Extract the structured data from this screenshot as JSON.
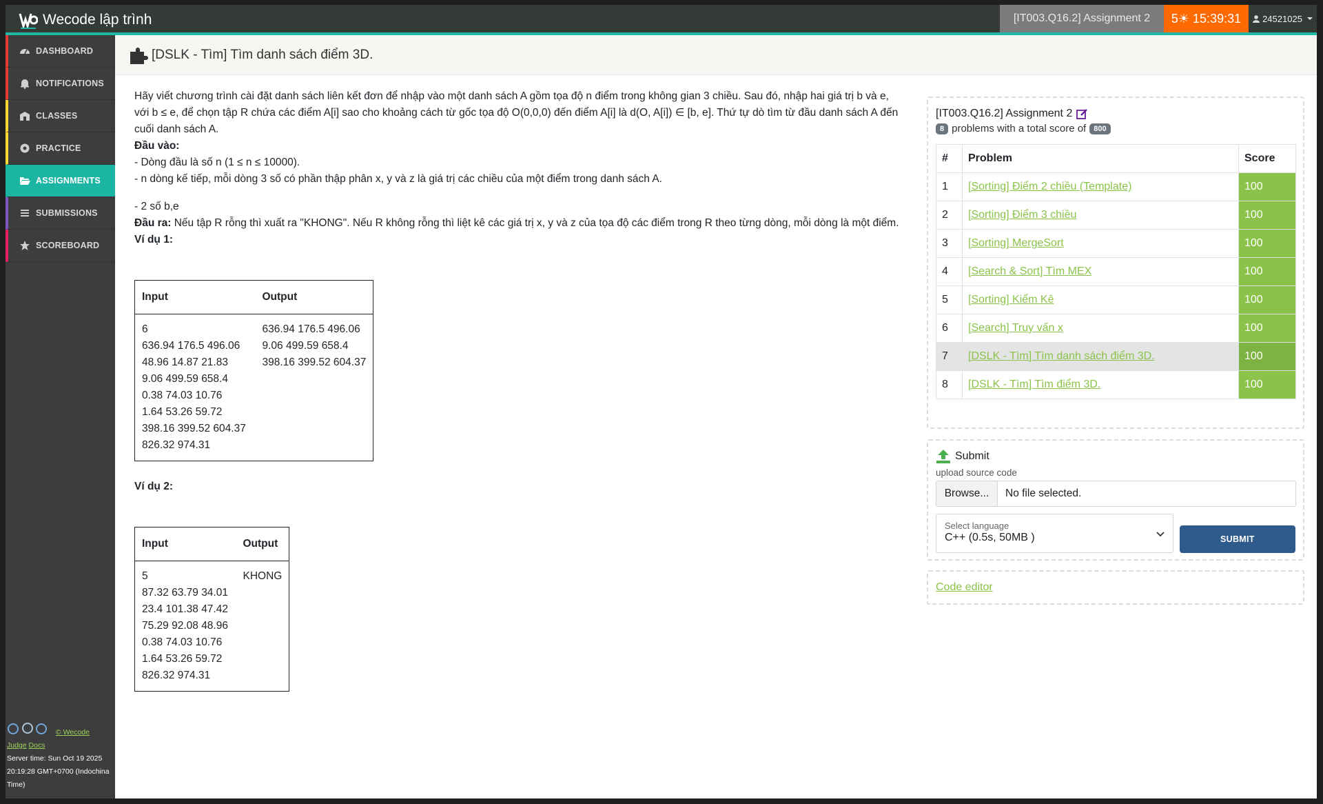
{
  "app": {
    "name": "Wecode lập trình"
  },
  "navbar": {
    "assignment": "[IT003.Q16.2] Assignment 2",
    "timer": "5☀ 15:39:31",
    "user": "24521025"
  },
  "sidebar": {
    "items": [
      {
        "label": "DASHBOARD",
        "icon": "dashboard-icon",
        "accent": "#e53935"
      },
      {
        "label": "NOTIFICATIONS",
        "icon": "bell-icon",
        "accent": "#e53935"
      },
      {
        "label": "CLASSES",
        "icon": "school-icon",
        "accent": "#fdd835"
      },
      {
        "label": "PRACTICE",
        "icon": "tools-icon",
        "accent": "#fdd835"
      },
      {
        "label": "ASSIGNMENTS",
        "icon": "folder-open-icon",
        "accent": "#1cb4a3"
      },
      {
        "label": "SUBMISSIONS",
        "icon": "list-icon",
        "accent": "#7e57c2"
      },
      {
        "label": "SCOREBOARD",
        "icon": "star-icon",
        "accent": "#e91e63"
      }
    ],
    "footer": {
      "credit": "© Wecode",
      "judge": "Judge",
      "docs": "Docs",
      "server_time": "Server time: Sun Oct 19 2025 20:19:28 GMT+0700 (Indochina Time)"
    }
  },
  "page": {
    "title": "[DSLK - Tìm] Tìm danh sách điểm 3D."
  },
  "problem": {
    "statement": "Hãy viết chương trình cài đặt danh sách liên kết đơn để nhập vào một danh sách A gồm tọa độ n điểm trong không gian 3 chiều. Sau đó, nhập hai giá trị b và e, với b ≤ e, để chọn tập R chứa các điểm A[i] sao cho khoảng cách từ gốc tọa độ O(0,0,0) đến điểm A[i] là d(O, A[i]) ∈ [b, e]. Thứ tự dò tìm từ đầu danh sách A đến cuối danh sách A.",
    "input_heading": "Đầu vào:",
    "input_line1": "- Dòng đầu là số n (1 ≤ n ≤ 10000).",
    "input_line2": "- n dòng kế tiếp, mỗi dòng 3 số có phần thập phân x, y và z là giá trị các chiều của một điểm trong danh sách A.",
    "input_line3": "- 2 số b,e",
    "output_heading": "Đầu ra:",
    "output_text": " Nếu tập R rỗng thì xuất ra \"KHONG\". Nếu R không rỗng thì liệt kê các giá trị x, y và z của tọa độ các điểm trong R theo từng dòng, mỗi dòng là một điểm.",
    "example1_heading": "Ví dụ 1:",
    "example2_heading": "Ví dụ 2:",
    "col_input": "Input",
    "col_output": "Output",
    "example1": {
      "input": "6\n636.94 176.5 496.06\n48.96 14.87 21.83\n9.06 499.59 658.4\n0.38 74.03 10.76\n1.64 53.26 59.72\n398.16 399.52 604.37\n826.32 974.31",
      "output": "636.94 176.5 496.06\n9.06 499.59 658.4\n398.16 399.52 604.37"
    },
    "example2": {
      "input": "5\n87.32 63.79 34.01\n23.4 101.38 47.42\n75.29 92.08 48.96\n0.38 74.03 10.76\n1.64 53.26 59.72\n826.32 974.31",
      "output": "KHONG"
    }
  },
  "assignment_panel": {
    "title": "[IT003.Q16.2] Assignment 2",
    "problem_count": "8",
    "summary_text": "problems with a total score of",
    "total_score": "800",
    "headers": {
      "num": "#",
      "problem": "Problem",
      "score": "Score"
    },
    "rows": [
      {
        "num": "1",
        "name": "[Sorting] Điểm 2 chiều (Template)",
        "score": "100"
      },
      {
        "num": "2",
        "name": "[Sorting] Điểm 3 chiều",
        "score": "100"
      },
      {
        "num": "3",
        "name": "[Sorting] MergeSort",
        "score": "100"
      },
      {
        "num": "4",
        "name": "[Search & Sort] Tìm MEX",
        "score": "100"
      },
      {
        "num": "5",
        "name": "[Sorting] Kiểm Kê",
        "score": "100"
      },
      {
        "num": "6",
        "name": "[Search] Truy vấn x",
        "score": "100"
      },
      {
        "num": "7",
        "name": "[DSLK - Tìm] Tìm danh sách điểm 3D.",
        "score": "100"
      },
      {
        "num": "8",
        "name": "[DSLK - Tìm] Tìm điểm 3D.",
        "score": "100"
      }
    ],
    "current_row": "7"
  },
  "submit_panel": {
    "title": "Submit",
    "upload_label": "upload source code",
    "browse": "Browse...",
    "file_status": "No file selected.",
    "language_label": "Select language",
    "language_value": "C++ (0.5s, 50MB )",
    "submit": "SUBMIT"
  },
  "editor_panel": {
    "link": " Code editor"
  },
  "colors": {
    "navbar": "#343a35",
    "accent_teal": "#1cb4a3",
    "timer": "#fe6a00",
    "score_green": "#8bc34a",
    "submit_blue": "#2f5b8c"
  }
}
